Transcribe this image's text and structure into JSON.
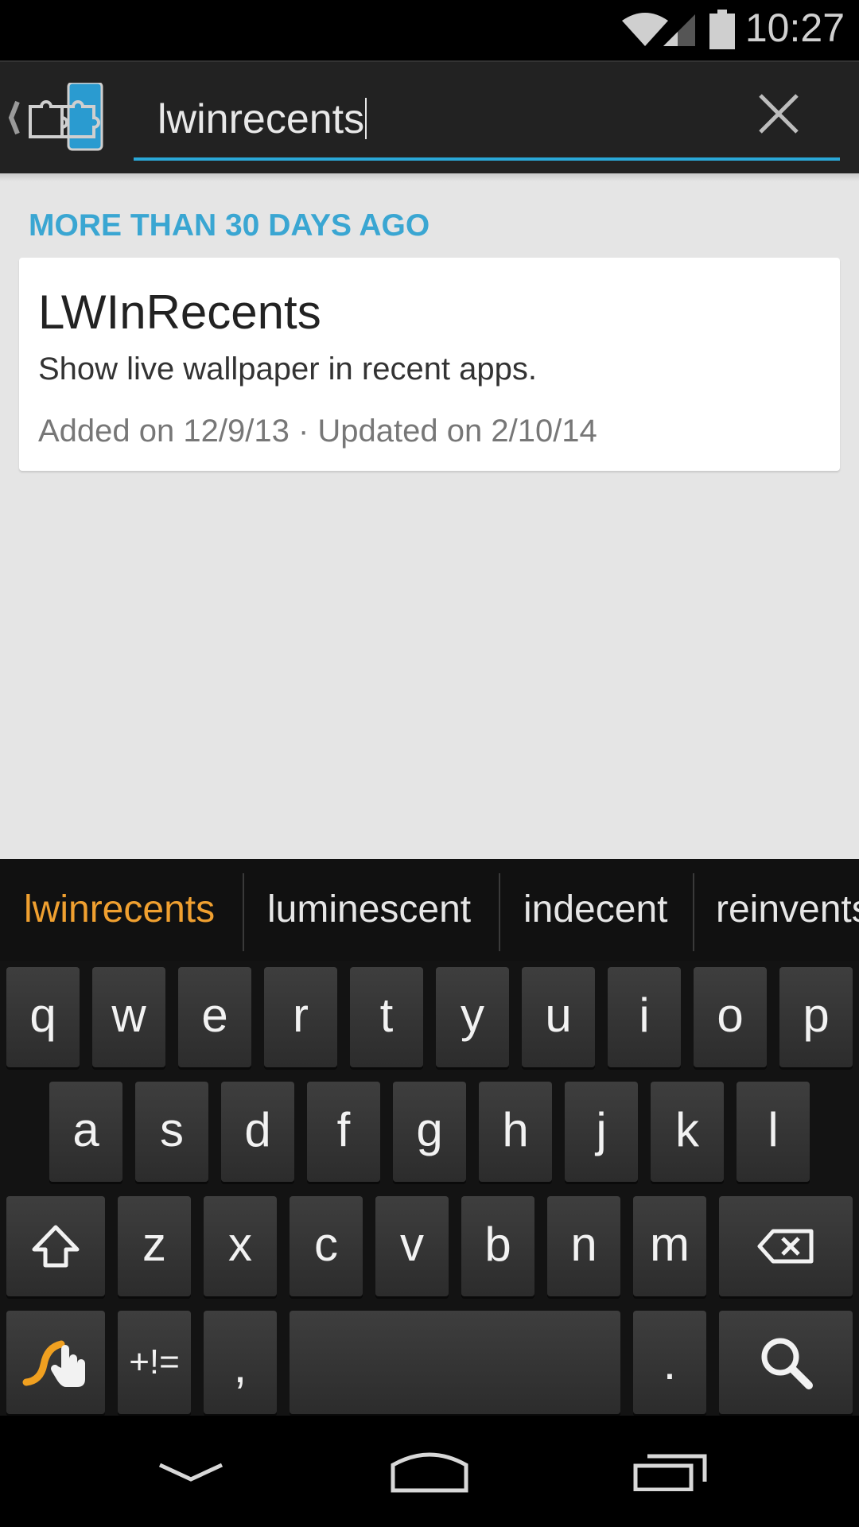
{
  "status_bar": {
    "time": "10:27",
    "icons": [
      "wifi-icon",
      "cell-signal-icon",
      "battery-icon"
    ]
  },
  "action_bar": {
    "app_icon": "xposed-installer-puzzle-icon",
    "search_value": "lwinrecents",
    "clear_icon": "close-icon",
    "accent_color": "#2aa8d8"
  },
  "results": {
    "section_header": "MORE THAN 30 DAYS AGO",
    "items": [
      {
        "title": "LWInRecents",
        "description": "Show live wallpaper in recent apps.",
        "meta": "Added on 12/9/13 · Updated on 2/10/14"
      }
    ]
  },
  "keyboard": {
    "suggestions": [
      "lwinrecents",
      "luminescent",
      "indecent",
      "reinvents"
    ],
    "row1": [
      "q",
      "w",
      "e",
      "r",
      "t",
      "y",
      "u",
      "i",
      "o",
      "p"
    ],
    "row2": [
      "a",
      "s",
      "d",
      "f",
      "g",
      "h",
      "j",
      "k",
      "l"
    ],
    "row3": [
      "z",
      "x",
      "c",
      "v",
      "b",
      "n",
      "m"
    ],
    "symbols_label": "+!=",
    "comma_label": ",",
    "period_label": ".",
    "special_icons": [
      "shift-icon",
      "backspace-icon",
      "swype-icon",
      "search-icon"
    ]
  },
  "nav_bar": {
    "icons": [
      "back-icon",
      "home-icon",
      "recent-apps-icon"
    ]
  }
}
